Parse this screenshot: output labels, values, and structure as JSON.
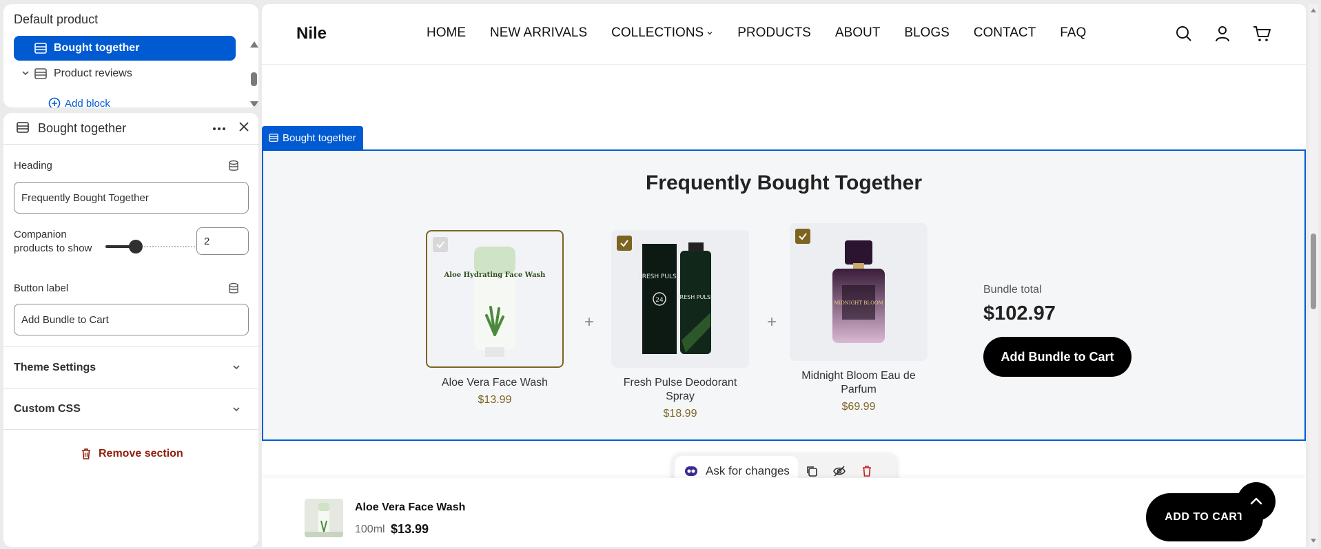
{
  "sidebar": {
    "template_title": "Default product",
    "tree": [
      {
        "label": "Bought together",
        "selected": true
      },
      {
        "label": "Product reviews",
        "selected": false
      }
    ],
    "add_block": "Add block"
  },
  "editor": {
    "title": "Bought together",
    "heading_label": "Heading",
    "heading_value": "Frequently Bought Together",
    "companion_label": "Companion products to show",
    "companion_value": "2",
    "button_label_label": "Button label",
    "button_label_value": "Add Bundle to Cart",
    "accordions": [
      "Theme Settings",
      "Custom CSS"
    ],
    "remove": "Remove section"
  },
  "store": {
    "logo": "Nile",
    "nav": [
      "HOME",
      "NEW ARRIVALS",
      "COLLECTIONS",
      "PRODUCTS",
      "ABOUT",
      "BLOGS",
      "CONTACT",
      "FAQ"
    ],
    "section_tag": "Bought together",
    "fbt_title": "Frequently Bought Together",
    "products": [
      {
        "name": "Aloe Vera Face Wash",
        "price": "$13.99",
        "checked": true,
        "disabled": true
      },
      {
        "name": "Fresh Pulse Deodorant Spray",
        "price": "$18.99",
        "checked": true,
        "disabled": false
      },
      {
        "name": "Midnight Bloom Eau de Parfum",
        "price": "$69.99",
        "checked": true,
        "disabled": false
      }
    ],
    "product_art": {
      "aloe_tube_text": "Aloe Hydrating Face Wash",
      "deo_text": "FRESH PULSE",
      "deo_badge": "24",
      "perfume_text": "MIDNIGHT BLOOM"
    },
    "bundle_label": "Bundle total",
    "bundle_total": "$102.97",
    "bundle_button": "Add Bundle to Cart",
    "ask_changes": "Ask for changes",
    "sticky": {
      "name": "Aloe Vera Face Wash",
      "variant": "100ml",
      "price": "$13.99",
      "button": "ADD TO CART"
    }
  },
  "colors": {
    "accent": "#005bd3",
    "gold": "#7c6420",
    "danger": "#8e1f0b"
  }
}
